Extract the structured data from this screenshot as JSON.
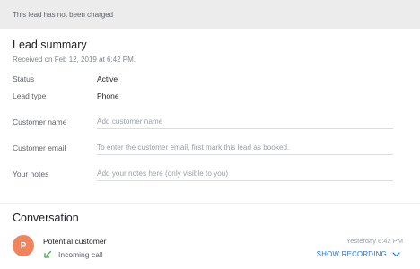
{
  "banner": {
    "text": "This lead has not been charged"
  },
  "summary": {
    "title": "Lead summary",
    "received": "Received on Feb 12, 2019 at 6:42 PM.",
    "rows": [
      {
        "label": "Status",
        "value": "Active"
      },
      {
        "label": "Lead type",
        "value": "Phone"
      }
    ],
    "fields": {
      "customer_name": {
        "label": "Customer name",
        "placeholder": "Add customer name",
        "value": ""
      },
      "customer_email": {
        "label": "Customer email",
        "placeholder": "To enter the customer email, first mark this lead as booked.",
        "value": ""
      },
      "notes": {
        "label": "Your notes",
        "placeholder": "Add your notes here (only visible to you)",
        "value": ""
      }
    }
  },
  "conversation": {
    "title": "Conversation",
    "items": [
      {
        "avatar_letter": "P",
        "avatar_color": "#f1845c",
        "name": "Potential customer",
        "timestamp": "Yesterday 6:42 PM",
        "call_icon": "incoming-call-arrow-icon",
        "call_type": "Incoming call",
        "action_label": "SHOW RECORDING",
        "action_icon": "chevron-down-icon"
      }
    ]
  },
  "colors": {
    "accent": "#1a73e8",
    "incoming_call": "#4caf50",
    "avatar": "#f1845c"
  }
}
